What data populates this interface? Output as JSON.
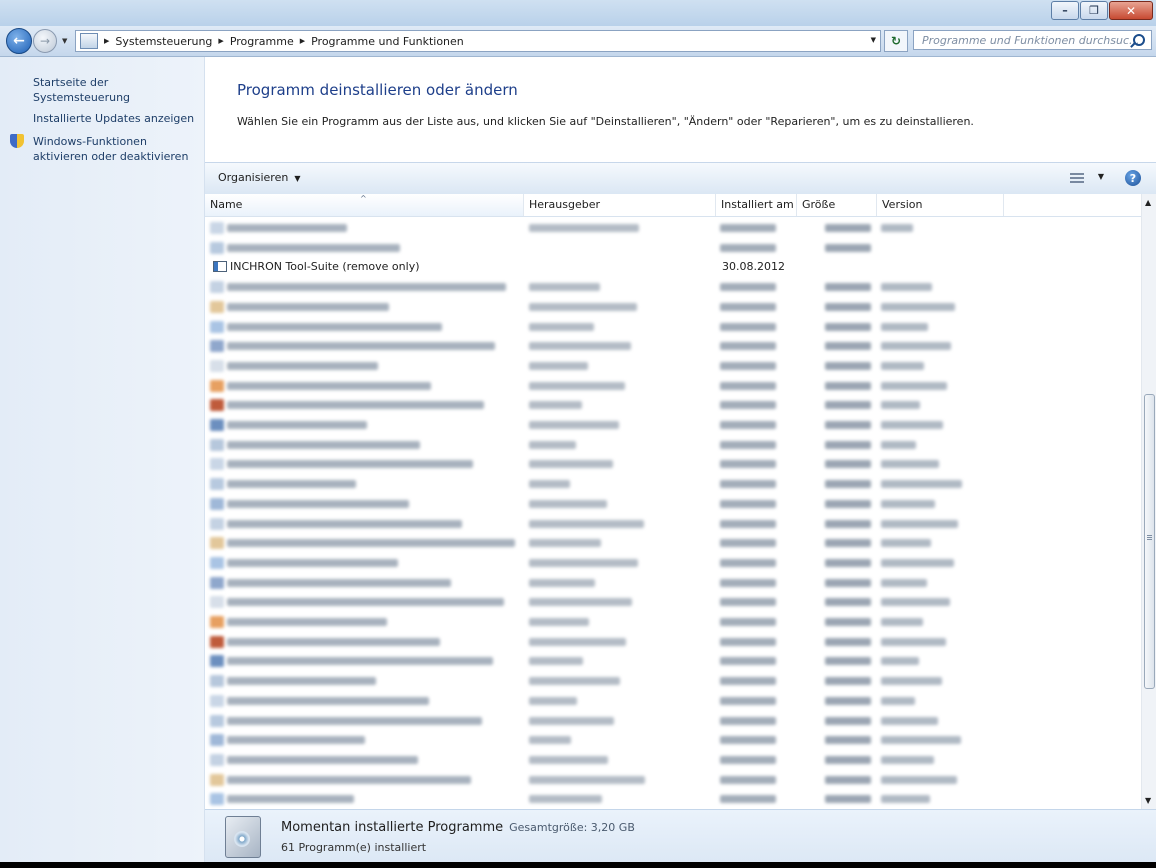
{
  "window": {
    "minimize_icon": "minimize-icon",
    "maximize_icon": "maximize-icon",
    "close_icon": "close-icon"
  },
  "address": {
    "crumbs": [
      "Systemsteuerung",
      "Programme",
      "Programme und Funktionen"
    ],
    "search_placeholder": "Programme und Funktionen durchsuc..."
  },
  "sidebar": {
    "home": "Startseite der Systemsteuerung",
    "updates": "Installierte Updates anzeigen",
    "features_line1": "Windows-Funktionen",
    "features_line2": "aktivieren oder deaktivieren"
  },
  "main": {
    "title": "Programm deinstallieren oder ändern",
    "description": "Wählen Sie ein Programm aus der Liste aus, und klicken Sie auf \"Deinstallieren\", \"Ändern\" oder \"Reparieren\", um es zu deinstallieren."
  },
  "toolbar": {
    "organize": "Organisieren"
  },
  "columns": {
    "name": "Name",
    "publisher": "Herausgeber",
    "installed": "Installiert am",
    "size": "Größe",
    "version": "Version"
  },
  "visible_row": {
    "name": "INCHRON Tool-Suite (remove only)",
    "installed": "30.08.2012"
  },
  "details": {
    "title": "Momentan installierte Programme",
    "size_label": "Gesamtgröße: 3,20 GB",
    "count": "61 Programm(e) installiert"
  },
  "colors": {
    "link": "#1e3e68",
    "title": "#1e3f8a",
    "pane_bg": "#e3ecf7"
  }
}
